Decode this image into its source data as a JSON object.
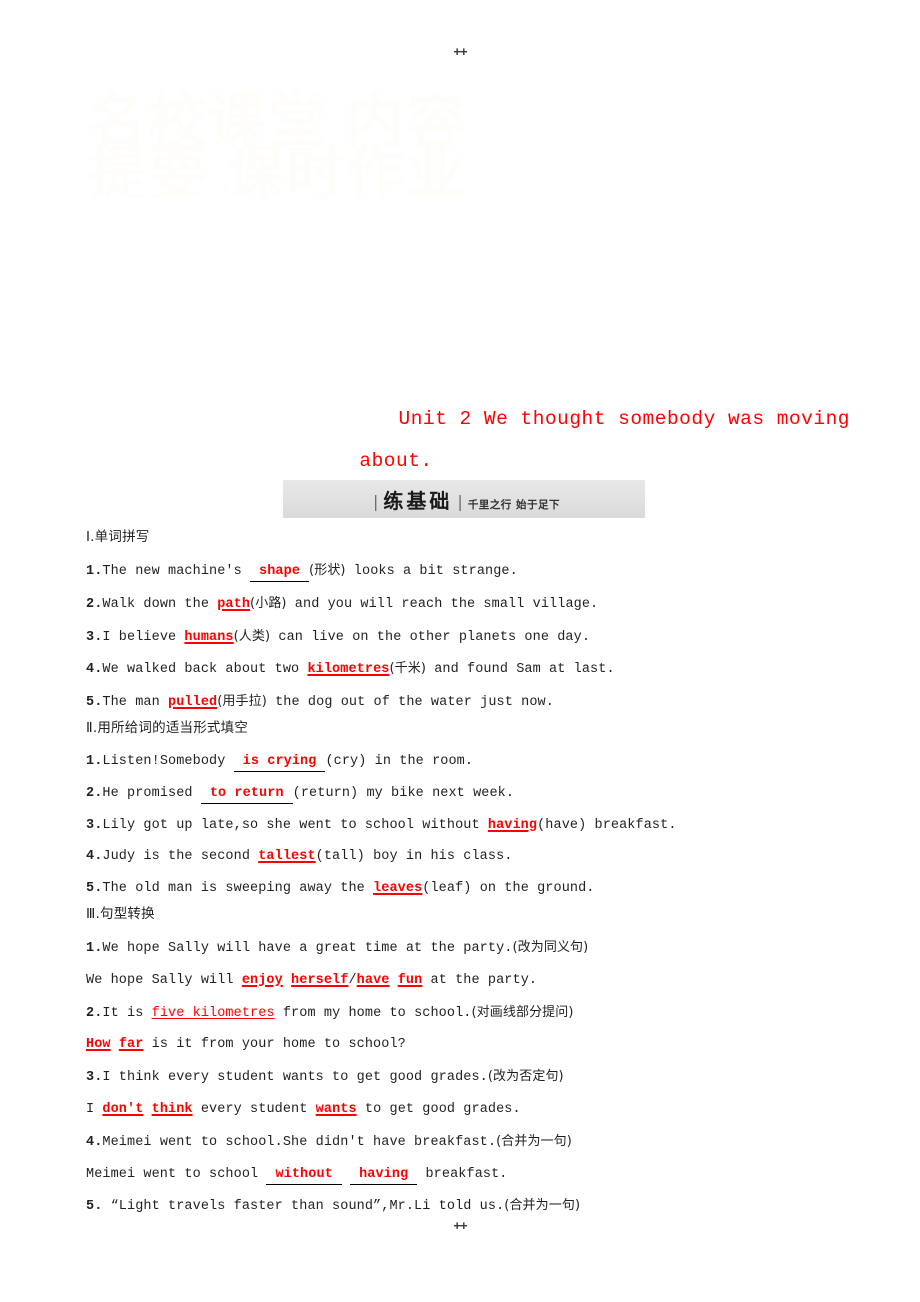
{
  "page": {
    "top_mark": "++",
    "bottom_mark": "++",
    "watermark": "名校课堂 内容提要 课时作业"
  },
  "title": {
    "line1": "Unit 2  We thought somebody was moving",
    "line2": "about."
  },
  "banner": {
    "bar_left": "|",
    "main": "练基础",
    "bar_right": "|",
    "sub": "千里之行  始于足下"
  },
  "sections": [
    {
      "heading": "Ⅰ.单词拼写",
      "items": [
        {
          "num": "1.",
          "parts": [
            {
              "type": "text",
              "text": "The new machine's "
            },
            {
              "type": "blank",
              "text": "shape"
            },
            {
              "type": "cn",
              "text": "(形状)"
            },
            {
              "type": "text",
              "text": " looks a bit strange."
            }
          ]
        },
        {
          "num": "2.",
          "parts": [
            {
              "type": "text",
              "text": "Walk down the "
            },
            {
              "type": "ans",
              "text": "path"
            },
            {
              "type": "cn",
              "text": "(小路)"
            },
            {
              "type": "text",
              "text": " and you will reach the small village."
            }
          ]
        },
        {
          "num": "3.",
          "parts": [
            {
              "type": "text",
              "text": "I believe "
            },
            {
              "type": "ans",
              "text": "humans"
            },
            {
              "type": "cn",
              "text": "(人类)"
            },
            {
              "type": "text",
              "text": " can live on the other planets one day."
            }
          ]
        },
        {
          "num": "4.",
          "parts": [
            {
              "type": "text",
              "text": "We walked back about two "
            },
            {
              "type": "ans",
              "text": "kilometres"
            },
            {
              "type": "cn",
              "text": "(千米)"
            },
            {
              "type": "text",
              "text": " and found Sam at last."
            }
          ]
        },
        {
          "num": "5.",
          "parts": [
            {
              "type": "text",
              "text": "The man "
            },
            {
              "type": "ans",
              "text": "pulled"
            },
            {
              "type": "cn",
              "text": "(用手拉)"
            },
            {
              "type": "text",
              "text": " the dog out of the water just now."
            }
          ]
        }
      ]
    },
    {
      "heading": "Ⅱ.用所给词的适当形式填空",
      "items": [
        {
          "num": "1.",
          "parts": [
            {
              "type": "text",
              "text": "Listen!Somebody "
            },
            {
              "type": "blank",
              "text": "is crying"
            },
            {
              "type": "text",
              "text": "(cry) in the room."
            }
          ]
        },
        {
          "num": "2.",
          "parts": [
            {
              "type": "text",
              "text": "He promised "
            },
            {
              "type": "blank",
              "text": "to return"
            },
            {
              "type": "text",
              "text": "(return) my bike next week."
            }
          ]
        },
        {
          "num": "3.",
          "parts": [
            {
              "type": "text",
              "text": "Lily got up late,so she went to school without "
            },
            {
              "type": "ans",
              "text": "having"
            },
            {
              "type": "text",
              "text": "(have) breakfast."
            }
          ]
        },
        {
          "num": "4.",
          "parts": [
            {
              "type": "text",
              "text": "Judy is the second "
            },
            {
              "type": "ans",
              "text": "tallest"
            },
            {
              "type": "text",
              "text": "(tall) boy in his class."
            }
          ]
        },
        {
          "num": "5.",
          "parts": [
            {
              "type": "text",
              "text": "The old man is sweeping away the "
            },
            {
              "type": "ans",
              "text": "leaves"
            },
            {
              "type": "text",
              "text": "(leaf) on the ground."
            }
          ]
        }
      ]
    },
    {
      "heading": "Ⅲ.句型转换",
      "items": [
        {
          "num": "1.",
          "parts": [
            {
              "type": "text",
              "text": "We hope Sally will have a great time at the party."
            },
            {
              "type": "cn",
              "text": "(改为同义句)"
            }
          ]
        },
        {
          "num": "",
          "parts": [
            {
              "type": "text",
              "text": "We hope Sally will "
            },
            {
              "type": "ans",
              "text": "enjoy"
            },
            {
              "type": "text",
              "text": " "
            },
            {
              "type": "ans",
              "text": "herself"
            },
            {
              "type": "text",
              "text": "/"
            },
            {
              "type": "ans",
              "text": "have"
            },
            {
              "type": "text",
              "text": " "
            },
            {
              "type": "ans",
              "text": "fun"
            },
            {
              "type": "text",
              "text": " at the party."
            }
          ]
        },
        {
          "num": "2.",
          "parts": [
            {
              "type": "text",
              "text": "It is "
            },
            {
              "type": "ans-plain",
              "text": "five kilometres"
            },
            {
              "type": "text",
              "text": " from my home to school."
            },
            {
              "type": "cn",
              "text": "(对画线部分提问)"
            }
          ]
        },
        {
          "num": "",
          "parts": [
            {
              "type": "ans",
              "text": "How"
            },
            {
              "type": "text",
              "text": " "
            },
            {
              "type": "ans",
              "text": "far"
            },
            {
              "type": "text",
              "text": " is it from your home to school?"
            }
          ]
        },
        {
          "num": "3.",
          "parts": [
            {
              "type": "text",
              "text": "I think every student wants to get good grades."
            },
            {
              "type": "cn",
              "text": "(改为否定句)"
            }
          ]
        },
        {
          "num": "",
          "parts": [
            {
              "type": "text",
              "text": "I "
            },
            {
              "type": "ans",
              "text": "don't"
            },
            {
              "type": "text",
              "text": " "
            },
            {
              "type": "ans",
              "text": "think"
            },
            {
              "type": "text",
              "text": " every student "
            },
            {
              "type": "ans",
              "text": "wants"
            },
            {
              "type": "text",
              "text": " to get good grades."
            }
          ]
        },
        {
          "num": "4.",
          "parts": [
            {
              "type": "text",
              "text": "Meimei went to school.She didn't have breakfast."
            },
            {
              "type": "cn",
              "text": "(合并为一句)"
            }
          ]
        },
        {
          "num": "",
          "parts": [
            {
              "type": "text",
              "text": "Meimei went to school "
            },
            {
              "type": "blank",
              "text": "without"
            },
            {
              "type": "text",
              "text": " "
            },
            {
              "type": "blank",
              "text": "having"
            },
            {
              "type": "text",
              "text": " breakfast."
            }
          ]
        },
        {
          "num": "5.",
          "parts": [
            {
              "type": "text",
              "text": " “Light travels faster than sound”,Mr.Li told us."
            },
            {
              "type": "cn",
              "text": "(合并为一句)"
            }
          ]
        }
      ]
    }
  ]
}
